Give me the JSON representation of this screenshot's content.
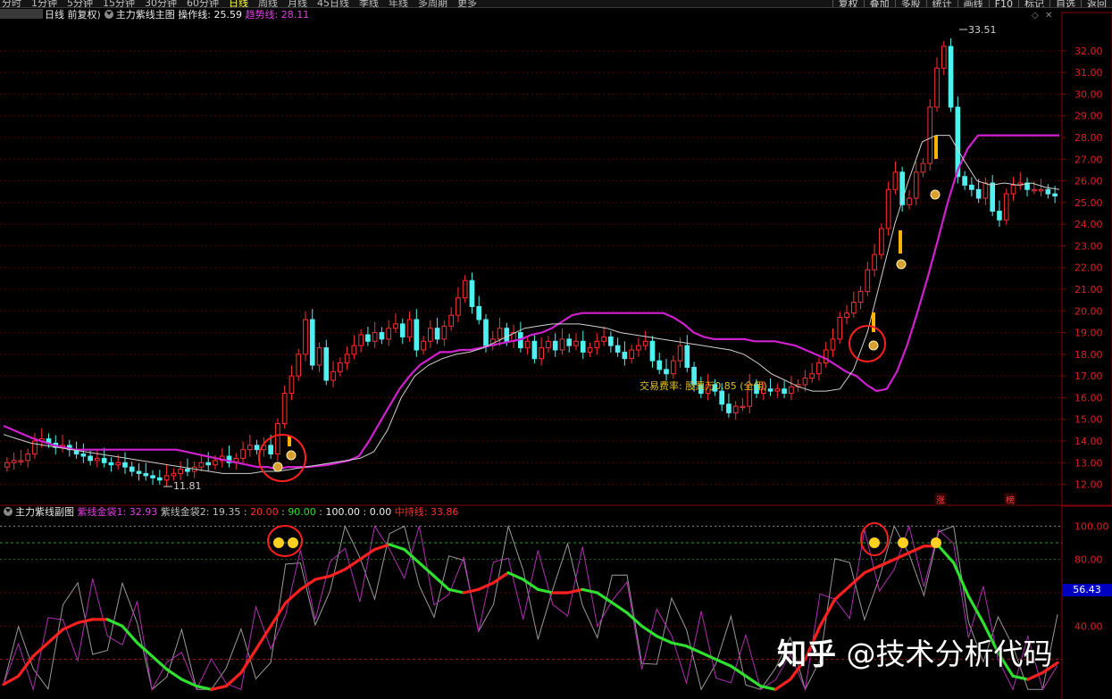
{
  "topbar": {
    "periods": [
      "分时",
      "1分钟",
      "5分钟",
      "15分钟",
      "30分钟",
      "60分钟",
      "日线",
      "周线",
      "月线",
      "45日线",
      "季线",
      "年线",
      "多周期",
      "更多"
    ],
    "active_period": "日线",
    "tools": [
      "复权",
      "叠加",
      "多股",
      "统计",
      "画线",
      "F10",
      "标记",
      "自选",
      "返回"
    ]
  },
  "main_legend": {
    "mode": "日线 前复权",
    "indicator": "主力紫线主图",
    "op_label": "操作线: 25.59",
    "trend_label": "趋势线: 28.11"
  },
  "sub_legend": {
    "indicator": "主力紫线副图",
    "gold1": "紫线金袋1: 32.93",
    "gold2": "紫线金袋2: 19.35",
    "v1": "20.00",
    "v2": "90.00",
    "v3": "100.00",
    "v4": "0.00",
    "mid": "中持线: 33.86"
  },
  "fee_note": "交易费率: 股票万0.85 (全佣)",
  "price_high_label": "33.51",
  "price_low_label": "11.81",
  "right_tags": [
    "涨",
    "榜"
  ],
  "osc_value_badge": "56.43",
  "watermark": {
    "brand": "知乎",
    "handle": "@技术分析代码"
  },
  "colors": {
    "up": "#ff3030",
    "down": "#50f0f0",
    "trend": "#d020d0",
    "op": "#d0d0d0",
    "gold": "#ffb000",
    "osc_red": "#ff2020",
    "osc_green": "#30e030"
  },
  "chart_data": [
    {
      "type": "candlestick",
      "title": "主力紫线主图",
      "ylim": [
        11.2,
        33.6
      ],
      "yticks": [
        12.0,
        13.0,
        14.0,
        15.0,
        16.0,
        17.0,
        18.0,
        19.0,
        20.0,
        21.0,
        22.0,
        23.0,
        24.0,
        25.0,
        26.0,
        27.0,
        28.0,
        29.0,
        30.0,
        31.0,
        32.0
      ],
      "close": [
        13.0,
        13.1,
        13.1,
        13.4,
        14.0,
        14.1,
        13.9,
        13.7,
        13.8,
        13.6,
        13.4,
        13.3,
        13.1,
        13.2,
        13.0,
        12.9,
        13.0,
        12.8,
        12.6,
        12.5,
        12.4,
        12.3,
        12.2,
        12.4,
        12.5,
        12.7,
        12.6,
        12.8,
        13.0,
        12.9,
        13.1,
        13.3,
        13.0,
        13.2,
        13.6,
        13.8,
        13.6,
        13.8,
        13.4,
        14.8,
        16.2,
        17.0,
        18.0,
        19.6,
        17.5,
        18.3,
        16.8,
        17.2,
        17.6,
        18.0,
        18.4,
        18.9,
        18.6,
        19.0,
        18.7,
        19.2,
        19.4,
        18.8,
        19.6,
        18.2,
        18.6,
        19.2,
        18.7,
        19.3,
        19.8,
        20.6,
        21.4,
        20.2,
        19.6,
        18.4,
        18.7,
        19.2,
        18.6,
        19.0,
        18.3,
        18.6,
        17.8,
        18.3,
        18.6,
        18.2,
        18.7,
        18.4,
        18.6,
        18.1,
        18.3,
        18.6,
        18.8,
        18.4,
        18.1,
        17.8,
        18.2,
        18.4,
        18.6,
        17.7,
        17.3,
        17.1,
        17.7,
        18.4,
        17.4,
        16.6,
        16.2,
        16.6,
        16.3,
        15.7,
        15.3,
        15.6,
        15.6,
        16.6,
        16.2,
        16.4,
        16.3,
        16.4,
        16.2,
        16.5,
        16.6,
        16.9,
        17.1,
        17.6,
        18.2,
        18.7,
        19.7,
        19.9,
        20.4,
        20.9,
        21.9,
        22.6,
        23.8,
        25.6,
        26.4,
        24.9,
        25.2,
        26.4,
        26.8,
        29.4,
        31.2,
        32.2,
        29.4,
        26.2,
        25.8,
        25.6,
        25.2,
        25.9,
        24.6,
        24.2,
        25.4,
        25.8,
        25.9,
        25.6,
        25.6,
        25.6,
        25.4,
        25.3
      ],
      "trend_line": [
        14.7,
        14.5,
        14.3,
        14.1,
        13.95,
        13.8,
        13.7,
        13.6,
        13.6,
        13.6,
        13.6,
        13.6,
        13.6,
        13.6,
        13.6,
        13.6,
        13.6,
        13.6,
        13.5,
        13.4,
        13.3,
        13.2,
        13.1,
        13.0,
        12.9,
        12.8,
        12.8,
        12.7,
        12.8,
        12.8,
        12.8,
        12.85,
        12.9,
        13.0,
        13.1,
        13.3,
        14.0,
        14.8,
        15.6,
        16.4,
        17.0,
        17.5,
        17.8,
        18.1,
        18.1,
        18.2,
        18.2,
        18.3,
        18.4,
        18.5,
        18.6,
        18.7,
        18.9,
        19.0,
        19.2,
        19.5,
        19.8,
        19.9,
        19.9,
        19.9,
        19.9,
        19.9,
        19.9,
        19.9,
        19.9,
        19.9,
        19.7,
        19.4,
        19.0,
        18.8,
        18.7,
        18.7,
        18.7,
        18.7,
        18.6,
        18.6,
        18.6,
        18.5,
        18.4,
        18.2,
        18.0,
        17.8,
        17.5,
        17.2,
        17.0,
        16.6,
        16.3,
        16.4,
        17.2,
        18.4,
        19.9,
        21.5,
        23.2,
        25.0,
        26.5,
        27.5,
        28.1,
        28.1,
        28.1,
        28.1,
        28.1,
        28.1,
        28.1,
        28.1,
        28.1
      ],
      "op_line": [
        14.3,
        14.1,
        13.9,
        13.8,
        13.7,
        13.6,
        13.5,
        13.4,
        13.3,
        13.2,
        13.1,
        13.0,
        12.9,
        12.8,
        12.7,
        12.6,
        12.5,
        12.5,
        12.5,
        12.6,
        12.6,
        12.7,
        12.8,
        12.9,
        13.0,
        13.1,
        13.2,
        13.5,
        14.5,
        16.0,
        17.0,
        17.5,
        17.8,
        18.0,
        18.1,
        18.3,
        18.6,
        18.9,
        19.2,
        19.3,
        19.4,
        19.4,
        19.4,
        19.3,
        19.2,
        19.0,
        18.9,
        18.8,
        18.7,
        18.6,
        18.5,
        18.4,
        18.3,
        18.2,
        18.0,
        17.6,
        17.1,
        16.8,
        16.5,
        16.3,
        16.3,
        16.4,
        17.3,
        19.0,
        21.5,
        24.0,
        26.0,
        27.8,
        28.1,
        28.1,
        27.0,
        26.0,
        25.8,
        25.9,
        25.8,
        25.9,
        25.7,
        25.6
      ],
      "annotations": [
        "33.51",
        "11.81"
      ]
    },
    {
      "type": "line",
      "title": "主力紫线副图",
      "ylim": [
        0,
        105
      ],
      "yticks": [
        40.0,
        60.0,
        80.0,
        100.0
      ],
      "series": [
        {
          "name": "中持线",
          "values": [
            5,
            10,
            22,
            30,
            38,
            42,
            44,
            44,
            40,
            30,
            22,
            14,
            8,
            4,
            2,
            4,
            12,
            26,
            40,
            54,
            62,
            68,
            70,
            74,
            80,
            86,
            89,
            86,
            78,
            70,
            62,
            60,
            62,
            66,
            72,
            68,
            62,
            60,
            60,
            62,
            60,
            54,
            48,
            40,
            34,
            30,
            28,
            24,
            20,
            16,
            10,
            4,
            2,
            8,
            20,
            40,
            56,
            64,
            72,
            76,
            80,
            84,
            88,
            88,
            78,
            58,
            42,
            24,
            10,
            8,
            12,
            18
          ]
        }
      ]
    }
  ]
}
